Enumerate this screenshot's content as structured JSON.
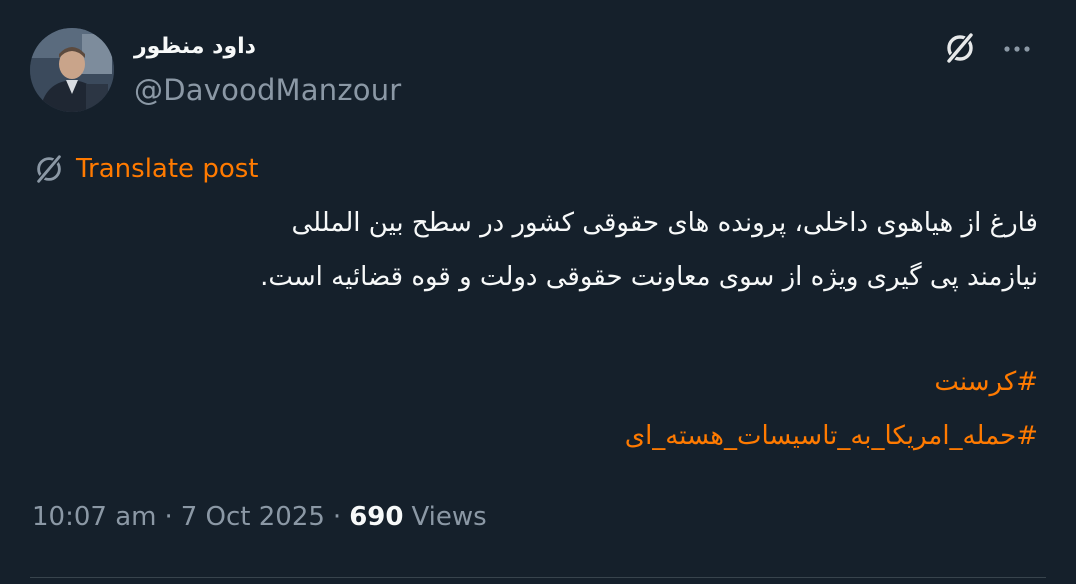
{
  "author": {
    "display_name": "داود منظور",
    "handle": "@DavoodManzour"
  },
  "header_icons": {
    "grok": "grok-icon",
    "more": "more-icon"
  },
  "translate": {
    "icon": "grok-icon",
    "label": "Translate post"
  },
  "post": {
    "lines": [
      "فارغ از هیاهوی داخلی، پرونده های حقوقی کشور در سطح بین المللی",
      "نیازمند پی گیری ویژه از سوی معاونت حقوقی دولت و قوه قضائیه است."
    ],
    "hashtags": [
      "#کرسنت",
      "#حمله_امریکا_به_تاسیسات_هسته_ای"
    ]
  },
  "meta": {
    "time": "10:07 am",
    "date": "7 Oct 2025",
    "views_count": "690",
    "views_label": "Views"
  },
  "colors": {
    "background": "#15202b",
    "accent": "#ff7a00",
    "secondary_text": "#8b98a5",
    "primary_text": "#f7f9f9"
  }
}
